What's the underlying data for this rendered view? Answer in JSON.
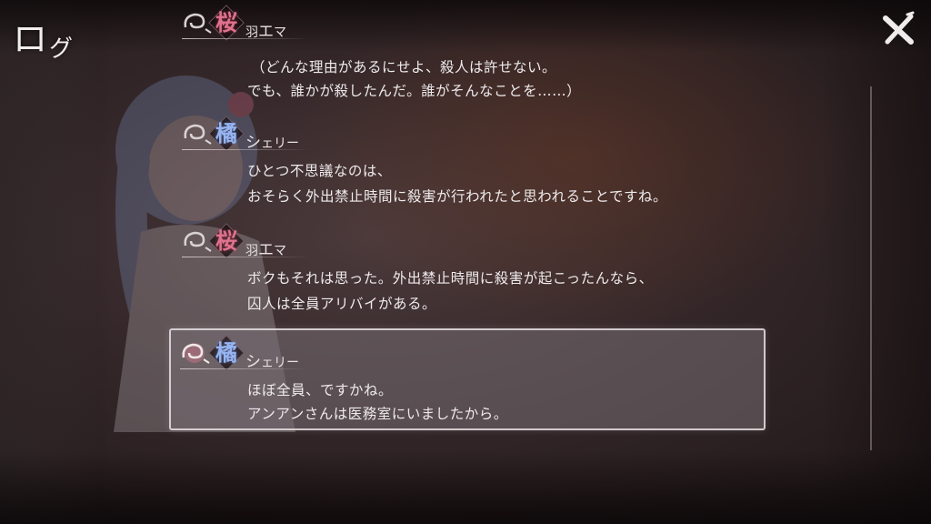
{
  "header": {
    "title_main": "ロ",
    "title_small": "グ"
  },
  "log": [
    {
      "speaker_kanji": "桜",
      "speaker_small": "羽",
      "speaker_rest": "エ",
      "speaker_tail": "マ",
      "kanji_color": "#e0728e",
      "lines": [
        "（どんな理由があるにせよ、殺人は許せない。",
        "でも、誰かが殺したんだ。誰がそんなことを……）"
      ]
    },
    {
      "speaker_kanji": "橘",
      "speaker_small": "",
      "speaker_rest": "シ",
      "speaker_tail": "ェリー",
      "kanji_color": "#96b4f0",
      "lines": [
        "ひとつ不思議なのは、",
        "おそらく外出禁止時間に殺害が行われたと思われることですね。"
      ]
    },
    {
      "speaker_kanji": "桜",
      "speaker_small": "羽",
      "speaker_rest": "エ",
      "speaker_tail": "マ",
      "kanji_color": "#e0728e",
      "lines": [
        "ボクもそれは思った。外出禁止時間に殺害が起こったんなら、",
        "囚人は全員アリバイがある。"
      ]
    },
    {
      "speaker_kanji": "橘",
      "speaker_small": "",
      "speaker_rest": "シ",
      "speaker_tail": "ェリー",
      "kanji_color": "#96b4f0",
      "lines": [
        "ほぼ全員、ですかね。",
        "アンアンさんは医務室にいましたから。"
      ],
      "selected": true
    }
  ],
  "icons": {
    "close": "close-x-icon",
    "voice": "voice-replay-icon"
  }
}
